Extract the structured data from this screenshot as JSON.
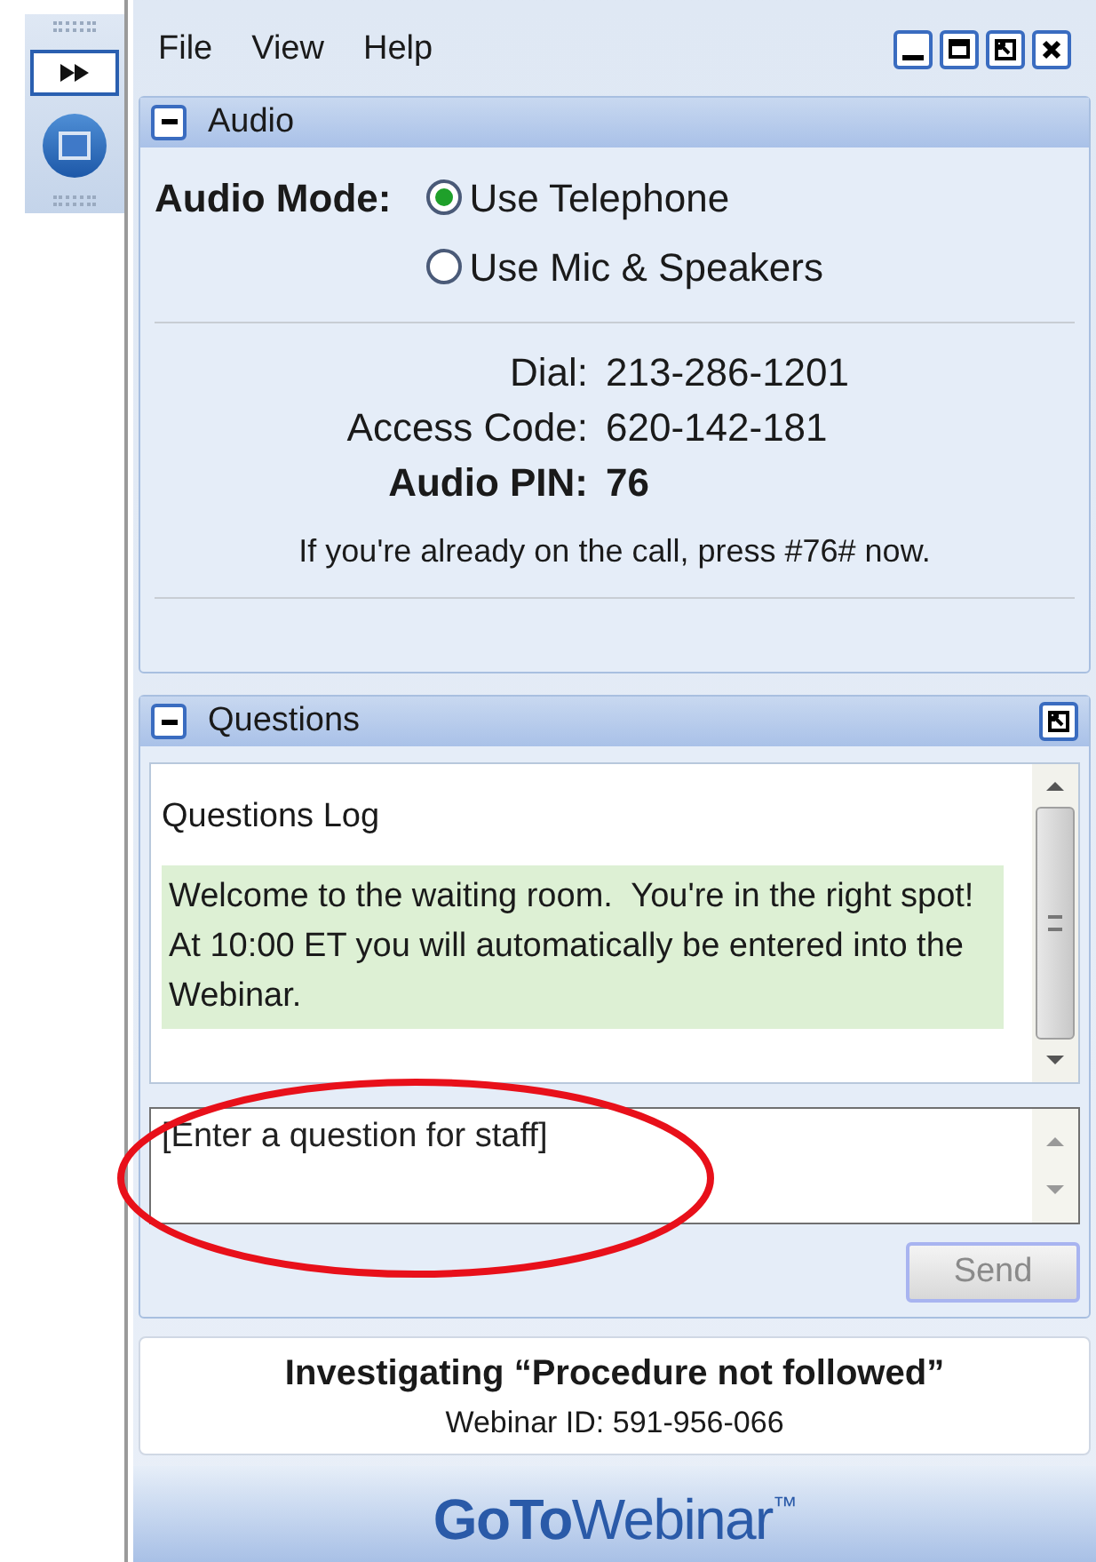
{
  "menu": [
    {
      "label": "File"
    },
    {
      "label": "View"
    },
    {
      "label": "Help"
    }
  ],
  "audio": {
    "title": "Audio",
    "mode_label": "Audio Mode:",
    "options": [
      {
        "label": "Use Telephone",
        "selected": true
      },
      {
        "label": "Use Mic & Speakers",
        "selected": false
      }
    ],
    "fields": [
      {
        "label": "Dial:",
        "value": "213-286-1201",
        "emphasized": false
      },
      {
        "label": "Access Code:",
        "value": "620-142-181",
        "emphasized": false
      },
      {
        "label": "Audio PIN:",
        "value": "76",
        "emphasized": true
      }
    ],
    "note": "If you're already on the call, press #76# now."
  },
  "questions": {
    "title": "Questions",
    "log_title": "Questions Log",
    "messages": [
      "Welcome to the waiting room.  You're in the right spot!",
      "At 10:00 ET you will automatically be entered into the Webinar."
    ],
    "input": {
      "placeholder": "[Enter a question for staff]"
    },
    "send": {
      "label": "Send",
      "disabled": true
    }
  },
  "footer": {
    "title": "Investigating “Procedure not followed”",
    "webinar_id": "Webinar ID: 591-956-066"
  },
  "logo": {
    "bold": "GoTo",
    "light": "Webinar",
    "mark": "™"
  }
}
